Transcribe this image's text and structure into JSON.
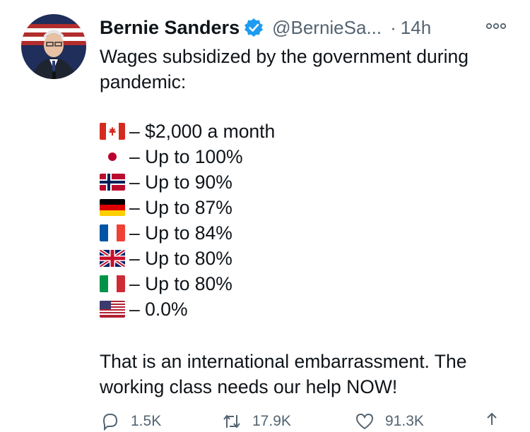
{
  "tweet": {
    "author_name": "Bernie Sanders",
    "handle": "@BernieSa...",
    "dot": "·",
    "time": "14h",
    "line1": "Wages subsidized by the government during",
    "line2": "pandemic:",
    "flags": [
      {
        "icon": "canada-flag-icon",
        "text": "– $2,000 a month"
      },
      {
        "icon": "japan-flag-icon",
        "text": "– Up to 100%"
      },
      {
        "icon": "norway-flag-icon",
        "text": "– Up to 90%"
      },
      {
        "icon": "germany-flag-icon",
        "text": "– Up to 87%"
      },
      {
        "icon": "france-flag-icon",
        "text": "– Up to 84%"
      },
      {
        "icon": "uk-flag-icon",
        "text": "– Up to 80%"
      },
      {
        "icon": "italy-flag-icon",
        "text": "– Up to 80%"
      },
      {
        "icon": "usa-flag-icon",
        "text": "– 0.0%"
      }
    ],
    "line3": "That is an international embarrassment. The",
    "line4": "working class needs our help NOW!"
  },
  "actions": {
    "replies": "1.5K",
    "retweets": "17.9K",
    "likes": "91.3K"
  },
  "colors": {
    "text": "#0f1419",
    "secondary": "#536471",
    "verified": "#1d9bf0"
  }
}
